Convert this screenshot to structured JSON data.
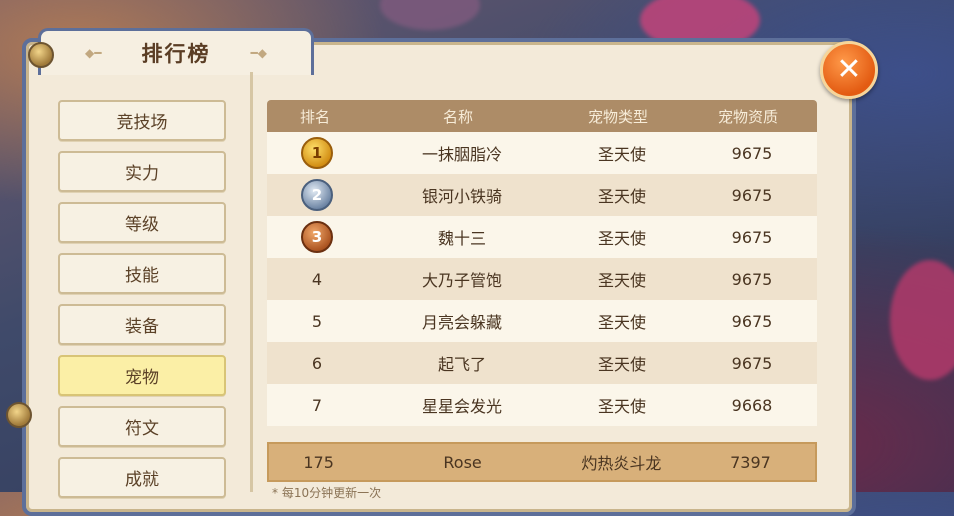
{
  "window": {
    "title": "排行榜"
  },
  "sidebar": {
    "items": [
      {
        "label": "竞技场",
        "active": false
      },
      {
        "label": "实力",
        "active": false
      },
      {
        "label": "等级",
        "active": false
      },
      {
        "label": "技能",
        "active": false
      },
      {
        "label": "装备",
        "active": false
      },
      {
        "label": "宠物",
        "active": true
      },
      {
        "label": "符文",
        "active": false
      },
      {
        "label": "成就",
        "active": false
      }
    ]
  },
  "table": {
    "headers": [
      "排名",
      "名称",
      "宠物类型",
      "宠物资质"
    ],
    "rows": [
      {
        "rank": "1",
        "medal": "gold",
        "name": "一抹胭脂冷",
        "type": "圣天使",
        "score": "9675"
      },
      {
        "rank": "2",
        "medal": "silver",
        "name": "银河小铁骑",
        "type": "圣天使",
        "score": "9675"
      },
      {
        "rank": "3",
        "medal": "bronze",
        "name": "魏十三",
        "type": "圣天使",
        "score": "9675"
      },
      {
        "rank": "4",
        "medal": "",
        "name": "大乃子管饱",
        "type": "圣天使",
        "score": "9675"
      },
      {
        "rank": "5",
        "medal": "",
        "name": "月亮会躲藏",
        "type": "圣天使",
        "score": "9675"
      },
      {
        "rank": "6",
        "medal": "",
        "name": "起飞了",
        "type": "圣天使",
        "score": "9675"
      },
      {
        "rank": "7",
        "medal": "",
        "name": "星星会发光",
        "type": "圣天使",
        "score": "9668"
      }
    ]
  },
  "my_rank": {
    "rank": "175",
    "name": "Rose",
    "type": "灼热炎斗龙",
    "score": "7397"
  },
  "footnote": "* 每10分钟更新一次",
  "colors": {
    "accent": "#e35b12",
    "header": "#ad8c67",
    "active_tab": "#fbefa6",
    "frame": "#5d6f9a"
  },
  "icons": {
    "close": "close-icon",
    "medals": [
      "gold-medal-icon",
      "silver-medal-icon",
      "bronze-medal-icon"
    ]
  }
}
